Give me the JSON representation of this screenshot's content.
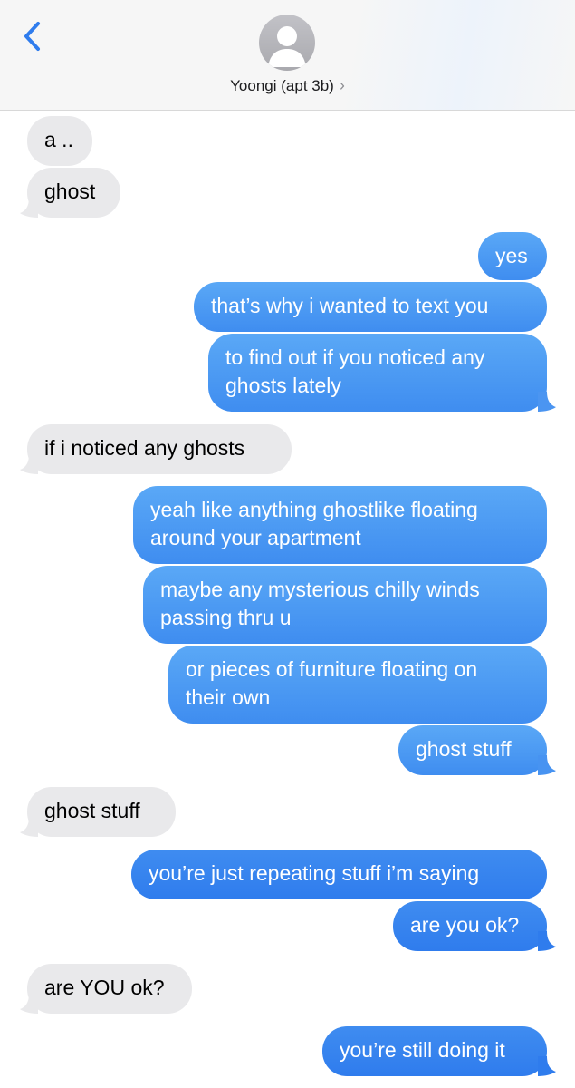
{
  "header": {
    "contact_name": "Yoongi (apt 3b)",
    "back_icon": "chevron-left-icon",
    "avatar_icon": "person-silhouette-icon",
    "disclosure_icon": "chevron-right-icon"
  },
  "colors": {
    "incoming_bubble": "#e9e9eb",
    "outgoing_bubble": "#3f8df0",
    "accent": "#2f7ced"
  },
  "messages": [
    {
      "from": "them",
      "text": "a .."
    },
    {
      "from": "them",
      "text": "ghost"
    },
    {
      "from": "me",
      "text": "yes"
    },
    {
      "from": "me",
      "text": "that’s why i wanted to text you"
    },
    {
      "from": "me",
      "text": "to find out if you noticed any\nghosts lately"
    },
    {
      "from": "them",
      "text": "if i noticed any ghosts"
    },
    {
      "from": "me",
      "text": "yeah like anything ghostlike floating\naround your apartment"
    },
    {
      "from": "me",
      "text": "maybe any mysterious chilly winds\npassing thru u"
    },
    {
      "from": "me",
      "text": "or pieces of furniture floating on\ntheir own"
    },
    {
      "from": "me",
      "text": "ghost stuff"
    },
    {
      "from": "them",
      "text": "ghost stuff"
    },
    {
      "from": "me",
      "text": "you’re just repeating stuff i’m saying"
    },
    {
      "from": "me",
      "text": "are you ok?"
    },
    {
      "from": "them",
      "text": "are YOU ok?"
    },
    {
      "from": "me",
      "text": "you’re still doing it"
    }
  ]
}
